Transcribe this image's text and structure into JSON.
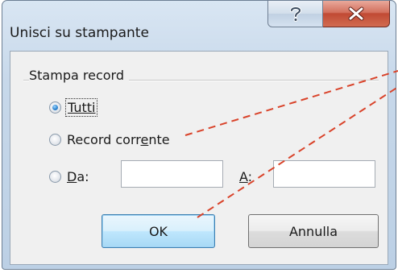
{
  "window": {
    "title": "Unisci su stampante"
  },
  "group": {
    "label": "Stampa record"
  },
  "options": {
    "all": {
      "label": "Tutti",
      "checked": true
    },
    "current": {
      "label_pre": "Record corr",
      "label_ul": "e",
      "label_post": "nte",
      "checked": false
    },
    "range": {
      "label_ul": "D",
      "label_post": "a:",
      "checked": false
    }
  },
  "fields": {
    "from_value": "",
    "to_label_ul": "A",
    "to_label_post": ":",
    "to_value": ""
  },
  "buttons": {
    "ok": "OK",
    "cancel": "Annulla"
  },
  "colors": {
    "annotation_line": "#d9432a",
    "radio_selected": "#2f86d0",
    "close_button": "#c04a34"
  },
  "icons": {
    "help": "question-mark",
    "close": "x-mark"
  }
}
